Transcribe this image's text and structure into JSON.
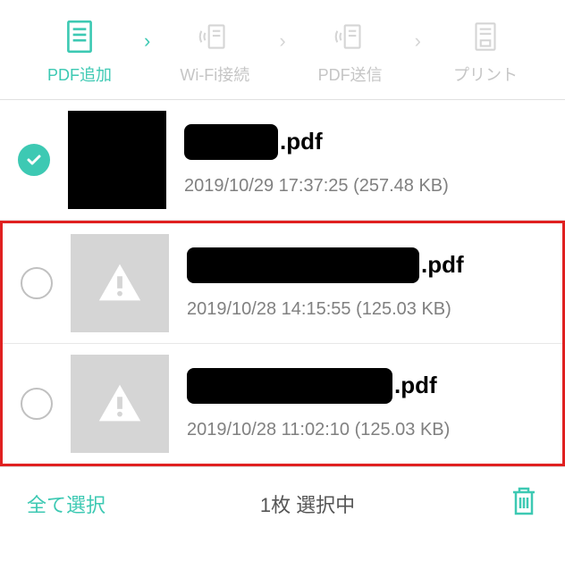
{
  "header": {
    "steps": [
      {
        "label": "PDF追加",
        "active": true
      },
      {
        "label": "Wi-Fi接続",
        "active": false
      },
      {
        "label": "PDF送信",
        "active": false
      },
      {
        "label": "プリント",
        "active": false
      }
    ]
  },
  "files": [
    {
      "selected": true,
      "thumbType": "dark",
      "ext": ".pdf",
      "redactedWidth": 105,
      "meta": "2019/10/29 17:37:25 (257.48 KB)"
    },
    {
      "selected": false,
      "thumbType": "warning",
      "ext": ".pdf",
      "redactedWidth": 260,
      "meta": "2019/10/28 14:15:55 (125.03 KB)"
    },
    {
      "selected": false,
      "thumbType": "warning",
      "ext": ".pdf",
      "redactedWidth": 230,
      "meta": "2019/10/28 11:02:10 (125.03 KB)"
    }
  ],
  "footer": {
    "selectAll": "全て選択",
    "status": "1枚 選択中"
  }
}
